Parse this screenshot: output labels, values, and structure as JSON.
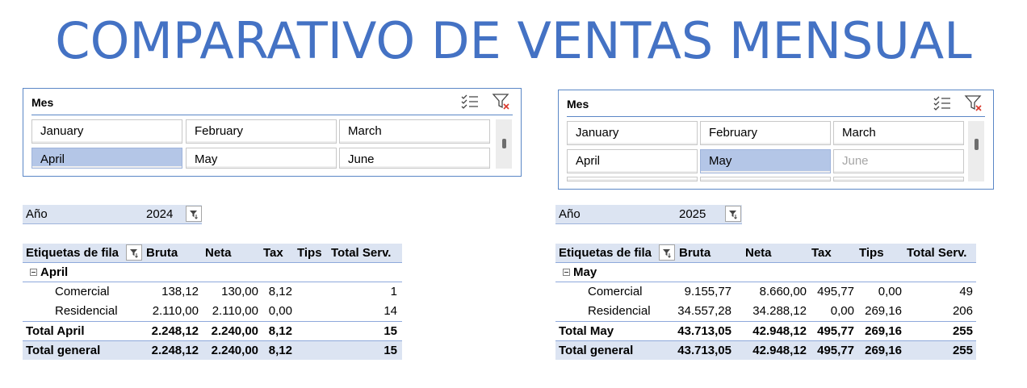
{
  "title": "COMPARATIVO DE VENTAS MENSUAL",
  "colors": {
    "accent": "#4472c4",
    "selected": "#b4c6e7",
    "header_bg": "#dce4f2"
  },
  "slicers": [
    {
      "title": "Mes",
      "months": [
        "January",
        "February",
        "March",
        "April",
        "May",
        "June"
      ],
      "selected": "April"
    },
    {
      "title": "Mes",
      "months": [
        "January",
        "February",
        "March",
        "April",
        "May",
        "June"
      ],
      "selected": "May",
      "no_data": [
        "June"
      ]
    }
  ],
  "pivots": [
    {
      "filter_label": "Año",
      "filter_value": "2024",
      "headers": [
        "Etiquetas de fila",
        "Bruta",
        "Neta",
        "Tax",
        "Tips",
        "Total Serv."
      ],
      "group": "April",
      "rows": [
        {
          "label": "Comercial",
          "bruta": "138,12",
          "neta": "130,00",
          "tax": "8,12",
          "tips": "",
          "total": "1"
        },
        {
          "label": "Residencial",
          "bruta": "2.110,00",
          "neta": "2.110,00",
          "tax": "0,00",
          "tips": "",
          "total": "14"
        }
      ],
      "subtotal": {
        "label": "Total April",
        "bruta": "2.248,12",
        "neta": "2.240,00",
        "tax": "8,12",
        "tips": "",
        "total": "15"
      },
      "grand": {
        "label": "Total general",
        "bruta": "2.248,12",
        "neta": "2.240,00",
        "tax": "8,12",
        "tips": "",
        "total": "15"
      }
    },
    {
      "filter_label": "Año",
      "filter_value": "2025",
      "headers": [
        "Etiquetas de fila",
        "Bruta",
        "Neta",
        "Tax",
        "Tips",
        "Total Serv."
      ],
      "group": "May",
      "rows": [
        {
          "label": "Comercial",
          "bruta": "9.155,77",
          "neta": "8.660,00",
          "tax": "495,77",
          "tips": "0,00",
          "total": "49"
        },
        {
          "label": "Residencial",
          "bruta": "34.557,28",
          "neta": "34.288,12",
          "tax": "0,00",
          "tips": "269,16",
          "total": "206"
        }
      ],
      "subtotal": {
        "label": "Total May",
        "bruta": "43.713,05",
        "neta": "42.948,12",
        "tax": "495,77",
        "tips": "269,16",
        "total": "255"
      },
      "grand": {
        "label": "Total general",
        "bruta": "43.713,05",
        "neta": "42.948,12",
        "tax": "495,77",
        "tips": "269,16",
        "total": "255"
      }
    }
  ]
}
